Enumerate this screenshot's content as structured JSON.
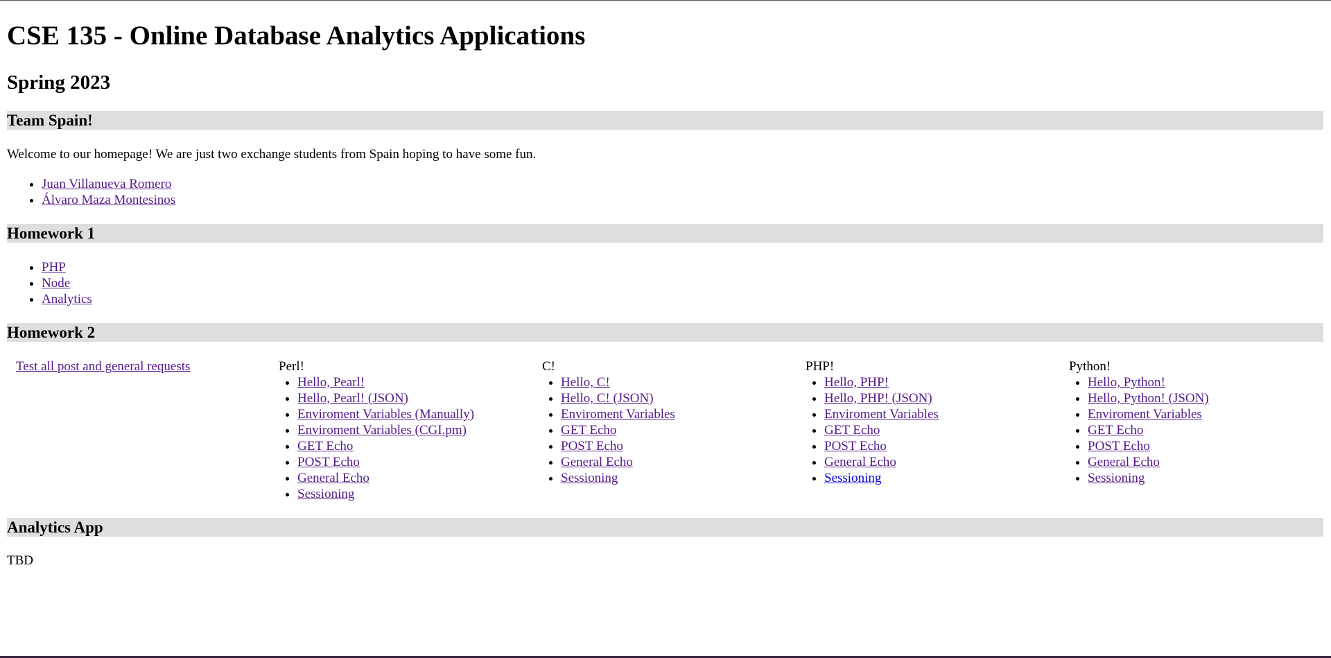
{
  "header": {
    "title": "CSE 135 - Online Database Analytics Applications",
    "semester": "Spring 2023"
  },
  "team": {
    "heading": "Team Spain!",
    "welcome": "Welcome to our homepage! We are just two exchange students from Spain hoping to have some fun.",
    "members": [
      {
        "label": "Juan Villanueva Romero"
      },
      {
        "label": "Álvaro Maza Montesinos"
      }
    ]
  },
  "homework1": {
    "heading": "Homework 1",
    "links": [
      {
        "label": "PHP"
      },
      {
        "label": "Node"
      },
      {
        "label": "Analytics"
      }
    ]
  },
  "homework2": {
    "heading": "Homework 2",
    "test_link": "Test all post and general requests",
    "columns": [
      {
        "title": "Perl!",
        "links": [
          {
            "label": "Hello, Pearl!"
          },
          {
            "label": "Hello, Pearl! (JSON)"
          },
          {
            "label": "Enviroment Variables (Manually)"
          },
          {
            "label": "Enviroment Variables (CGI.pm)"
          },
          {
            "label": "GET Echo"
          },
          {
            "label": "POST Echo"
          },
          {
            "label": "General Echo"
          },
          {
            "label": "Sessioning"
          }
        ]
      },
      {
        "title": "C!",
        "links": [
          {
            "label": "Hello, C!"
          },
          {
            "label": "Hello, C! (JSON)"
          },
          {
            "label": "Enviroment Variables"
          },
          {
            "label": "GET Echo"
          },
          {
            "label": "POST Echo"
          },
          {
            "label": "General Echo"
          },
          {
            "label": "Sessioning"
          }
        ]
      },
      {
        "title": "PHP!",
        "links": [
          {
            "label": "Hello, PHP!"
          },
          {
            "label": "Hello, PHP! (JSON)"
          },
          {
            "label": "Enviroment Variables"
          },
          {
            "label": "GET Echo"
          },
          {
            "label": "POST Echo"
          },
          {
            "label": "General Echo"
          },
          {
            "label": "Sessioning"
          }
        ]
      },
      {
        "title": "Python!",
        "links": [
          {
            "label": "Hello, Python!"
          },
          {
            "label": "Hello, Python! (JSON)"
          },
          {
            "label": "Enviroment Variables"
          },
          {
            "label": "GET Echo"
          },
          {
            "label": "POST Echo"
          },
          {
            "label": "General Echo"
          },
          {
            "label": "Sessioning"
          }
        ]
      }
    ]
  },
  "analytics": {
    "heading": "Analytics App",
    "body": "TBD"
  },
  "colors": {
    "visited_link": "#551a8b",
    "unvisited_link": "#0000ee",
    "section_background": "#dedede"
  }
}
